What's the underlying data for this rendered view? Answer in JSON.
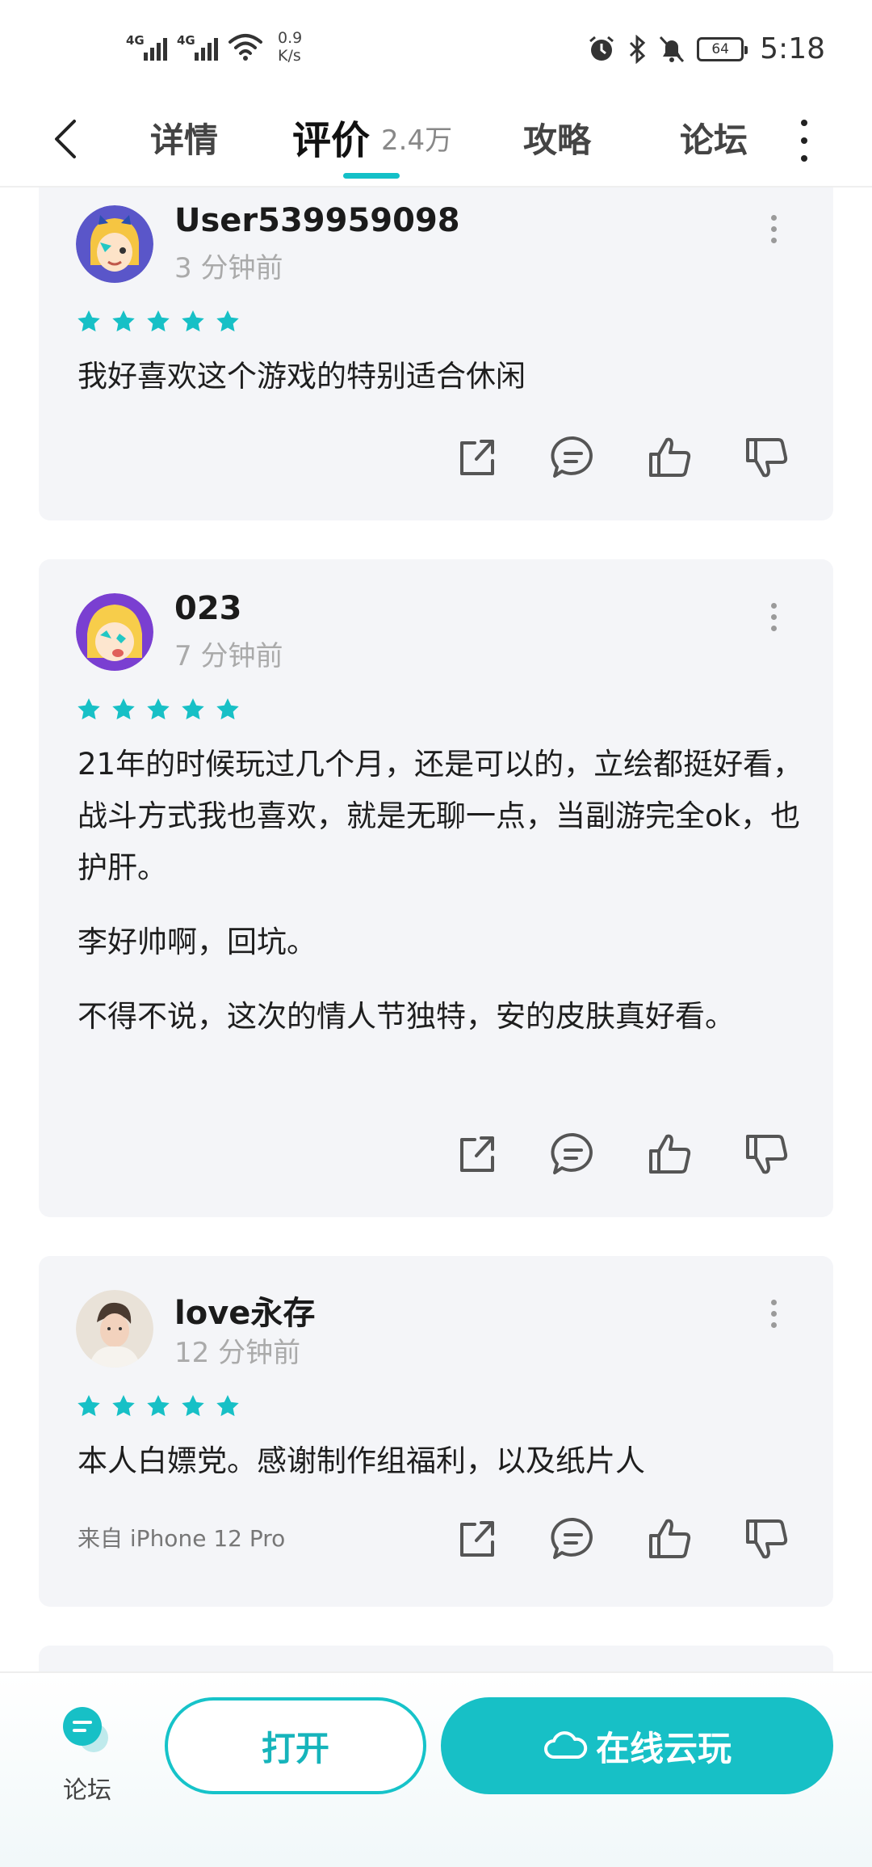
{
  "status_bar": {
    "network_1": "4G",
    "network_2": "4G",
    "speed_value": "0.9",
    "speed_unit": "K/s",
    "battery": "64",
    "time": "5:18"
  },
  "nav": {
    "tabs": [
      {
        "label": "详情"
      },
      {
        "label": "评价",
        "count": "2.4万",
        "active": true
      },
      {
        "label": "攻略"
      },
      {
        "label": "论坛"
      }
    ]
  },
  "reviews": [
    {
      "user": "User539959098",
      "time": "3 分钟前",
      "stars": 5,
      "paragraphs": [
        "我好喜欢这个游戏的特别适合休闲"
      ]
    },
    {
      "user": "023",
      "time": "7 分钟前",
      "stars": 5,
      "paragraphs": [
        "21年的时候玩过几个月，还是可以的，立绘都挺好看，战斗方式我也喜欢，就是无聊一点，当副游完全ok，也护肝。",
        "李好帅啊，回坑。",
        "不得不说，这次的情人节独特，安的皮肤真好看。"
      ]
    },
    {
      "user": "love永存",
      "time": "12 分钟前",
      "stars": 5,
      "paragraphs": [
        "本人白嫖党。感谢制作组福利，以及纸片人"
      ],
      "device": "来自 iPhone 12 Pro"
    }
  ],
  "bottom_bar": {
    "forum_label": "论坛",
    "open_label": "打开",
    "cloud_label": "在线云玩"
  },
  "colors": {
    "accent": "#17c0c6",
    "star": "#17c0c6",
    "card_bg": "#f4f5f8"
  },
  "icons": [
    "back-arrow-icon",
    "more-vertical-icon",
    "share-icon",
    "comment-icon",
    "thumbs-up-icon",
    "thumbs-down-icon",
    "cloud-icon",
    "forum-chat-icon",
    "alarm-icon",
    "bluetooth-icon",
    "mute-bell-icon",
    "wifi-icon"
  ]
}
